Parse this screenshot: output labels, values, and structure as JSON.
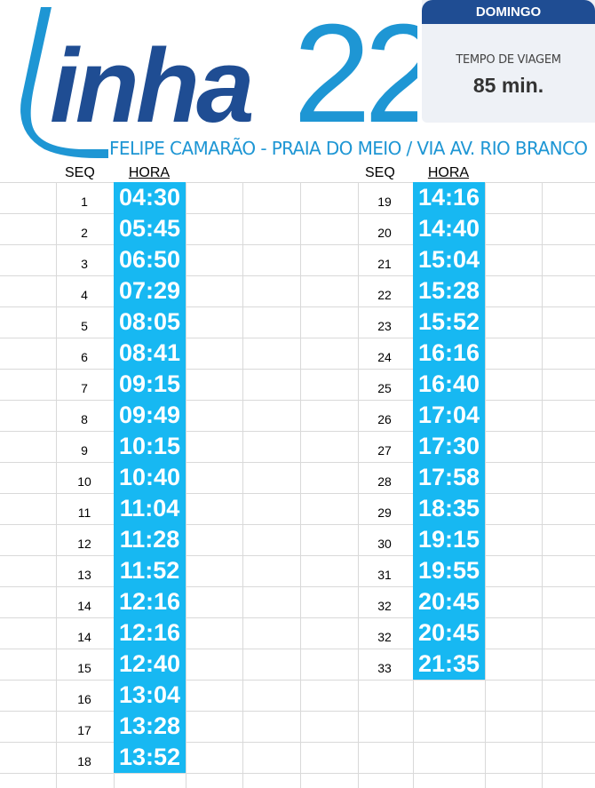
{
  "header": {
    "logo_text": "Linha22",
    "day": "DOMINGO",
    "travel_time_label": "TEMPO DE VIAGEM",
    "travel_time_value": "85 min.",
    "route": "FELIPE CAMARÃO - PRAIA DO MEIO / VIA AV. RIO BRANCO"
  },
  "columns": {
    "seq_label": "SEQ",
    "hora_label": "HORA"
  },
  "left": {
    "rows": [
      {
        "seq": "1",
        "hora": "04:30"
      },
      {
        "seq": "2",
        "hora": "05:45"
      },
      {
        "seq": "3",
        "hora": "06:50"
      },
      {
        "seq": "4",
        "hora": "07:29"
      },
      {
        "seq": "5",
        "hora": "08:05"
      },
      {
        "seq": "6",
        "hora": "08:41"
      },
      {
        "seq": "7",
        "hora": "09:15"
      },
      {
        "seq": "8",
        "hora": "09:49"
      },
      {
        "seq": "9",
        "hora": "10:15"
      },
      {
        "seq": "10",
        "hora": "10:40"
      },
      {
        "seq": "11",
        "hora": "11:04"
      },
      {
        "seq": "12",
        "hora": "11:28"
      },
      {
        "seq": "13",
        "hora": "11:52"
      },
      {
        "seq": "14",
        "hora": "12:16"
      },
      {
        "seq": "14",
        "hora": "12:16"
      },
      {
        "seq": "15",
        "hora": "12:40"
      },
      {
        "seq": "16",
        "hora": "13:04"
      },
      {
        "seq": "17",
        "hora": "13:28"
      },
      {
        "seq": "18",
        "hora": "13:52"
      }
    ]
  },
  "right": {
    "rows": [
      {
        "seq": "19",
        "hora": "14:16"
      },
      {
        "seq": "20",
        "hora": "14:40"
      },
      {
        "seq": "21",
        "hora": "15:04"
      },
      {
        "seq": "22",
        "hora": "15:28"
      },
      {
        "seq": "23",
        "hora": "15:52"
      },
      {
        "seq": "24",
        "hora": "16:16"
      },
      {
        "seq": "25",
        "hora": "16:40"
      },
      {
        "seq": "26",
        "hora": "17:04"
      },
      {
        "seq": "27",
        "hora": "17:30"
      },
      {
        "seq": "28",
        "hora": "17:58"
      },
      {
        "seq": "29",
        "hora": "18:35"
      },
      {
        "seq": "30",
        "hora": "19:15"
      },
      {
        "seq": "31",
        "hora": "19:55"
      },
      {
        "seq": "32",
        "hora": "20:45"
      },
      {
        "seq": "32",
        "hora": "20:45"
      },
      {
        "seq": "33",
        "hora": "21:35"
      }
    ]
  },
  "colors": {
    "brand_dark": "#1f4d93",
    "brand_light": "#1e96d4",
    "time_band": "#17b8f2"
  }
}
